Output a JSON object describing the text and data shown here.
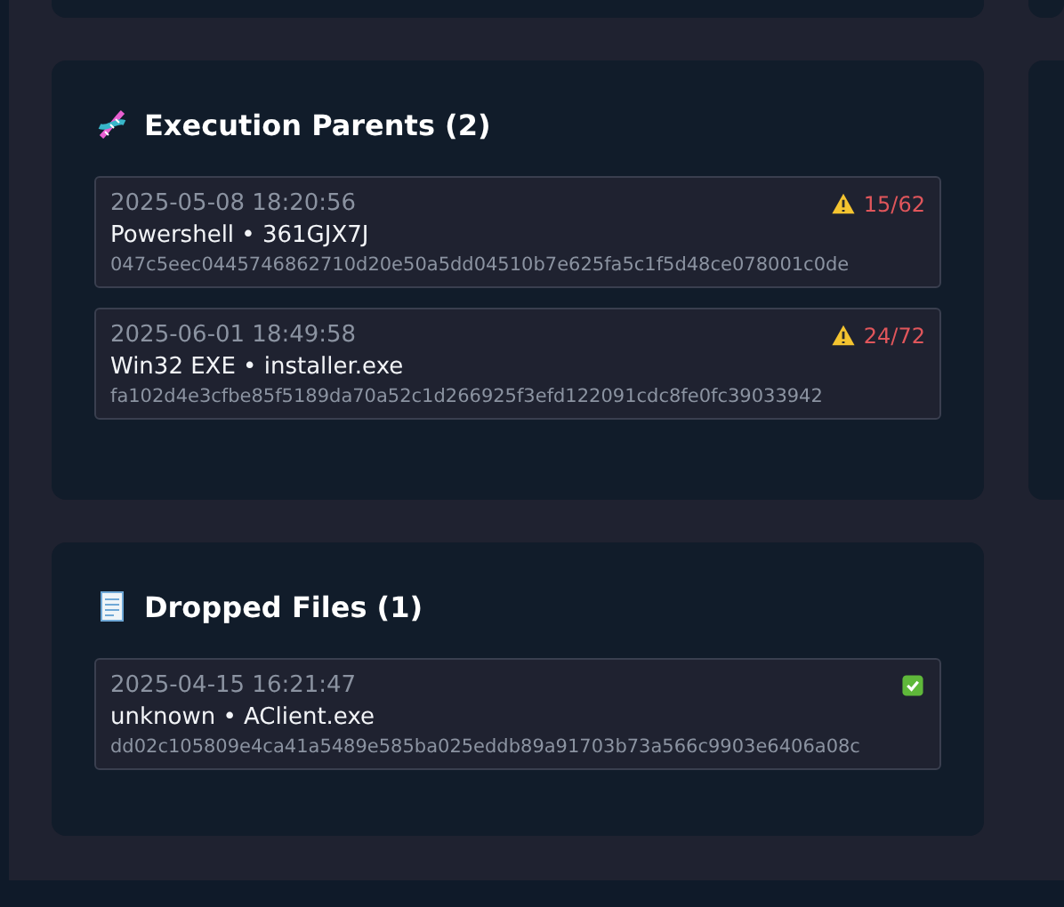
{
  "sections": [
    {
      "title": "Execution Parents (2)",
      "items": [
        {
          "date": "2025-05-08 18:20:56",
          "name": "Powershell • 361GJX7J",
          "hash": "047c5eec0445746862710d20e50a5dd04510b7e625fa5c1f5d48ce078001c0de",
          "flagged": true,
          "detections": "15/62"
        },
        {
          "date": "2025-06-01 18:49:58",
          "name": "Win32 EXE • installer.exe",
          "hash": "fa102d4e3cfbe85f5189da70a52c1d266925f3efd122091cdc8fe0fc39033942",
          "flagged": true,
          "detections": "24/72"
        }
      ]
    },
    {
      "title": "Dropped Files (1)",
      "items": [
        {
          "date": "2025-04-15 16:21:47",
          "name": "unknown • AClient.exe",
          "hash": "dd02c105809e4ca41a5489e585ba025eddb89a91703b73a566c9903e6406a08c",
          "flagged": false
        }
      ]
    }
  ]
}
